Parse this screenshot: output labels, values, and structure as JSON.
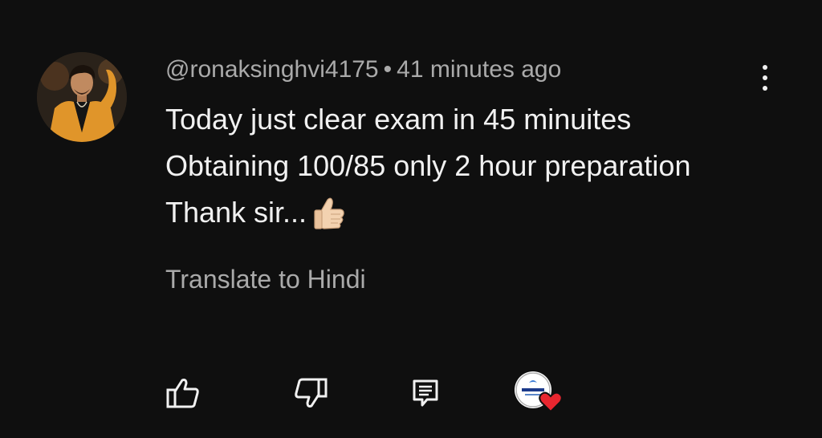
{
  "comment": {
    "author_handle": "@ronaksinghvi4175",
    "separator": "•",
    "timestamp": "41 minutes ago",
    "lines": [
      "Today just clear exam in 45 minuites",
      "Obtaining 100/85 only 2 hour preparation",
      "Thank sir..."
    ],
    "emoji": "thumbs-up-emoji",
    "translate_label": "Translate to Hindi"
  },
  "icons": {
    "avatar": "user-avatar",
    "menu": "more-vert-icon",
    "like": "thumb-up-outline-icon",
    "dislike": "thumb-down-outline-icon",
    "reply": "comment-reply-icon",
    "creator_heart": "creator-heart-icon"
  },
  "colors": {
    "background": "#0f0f0f",
    "primary_text": "#f1f1f1",
    "secondary_text": "#aaaaaa",
    "heart": "#e8262f",
    "avatar_jacket": "#e0952a"
  }
}
